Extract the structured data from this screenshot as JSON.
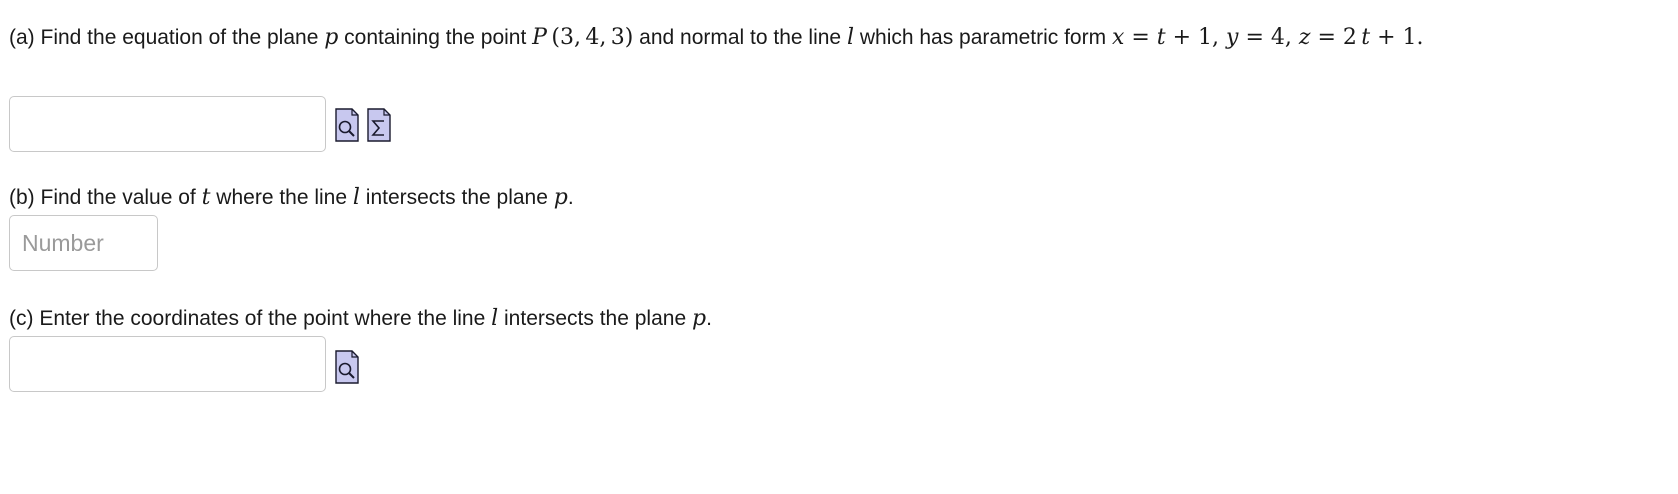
{
  "part_a": {
    "prefix": "(a) Find the equation of the plane",
    "plane_var": "p",
    "mid1": "containing the point",
    "point": "P (3, 4, 3)",
    "mid2": "and normal to the line",
    "line_var": "l",
    "mid3": "which has parametric form",
    "parametric": "x = t + 1, y = 4, z = 2 t + 1",
    "end": ".",
    "answer_value": ""
  },
  "part_b": {
    "prefix": "(b) Find the value of",
    "t_var": "t",
    "mid1": "where the line",
    "line_var": "l",
    "mid2": "intersects the plane",
    "plane_var": "p",
    "end": ".",
    "answer_placeholder": "Number",
    "answer_value": ""
  },
  "part_c": {
    "prefix": "(c) Enter the coordinates of the point where the line",
    "line_var": "l",
    "mid1": "intersects the plane",
    "plane_var": "p",
    "end": ".",
    "answer_value": ""
  },
  "icons": {
    "preview": "preview-magnifier-icon",
    "equation_editor": "sigma-equation-editor-icon",
    "icon_fill": "#c8c8ef",
    "icon_stroke": "#1a1a2e"
  }
}
